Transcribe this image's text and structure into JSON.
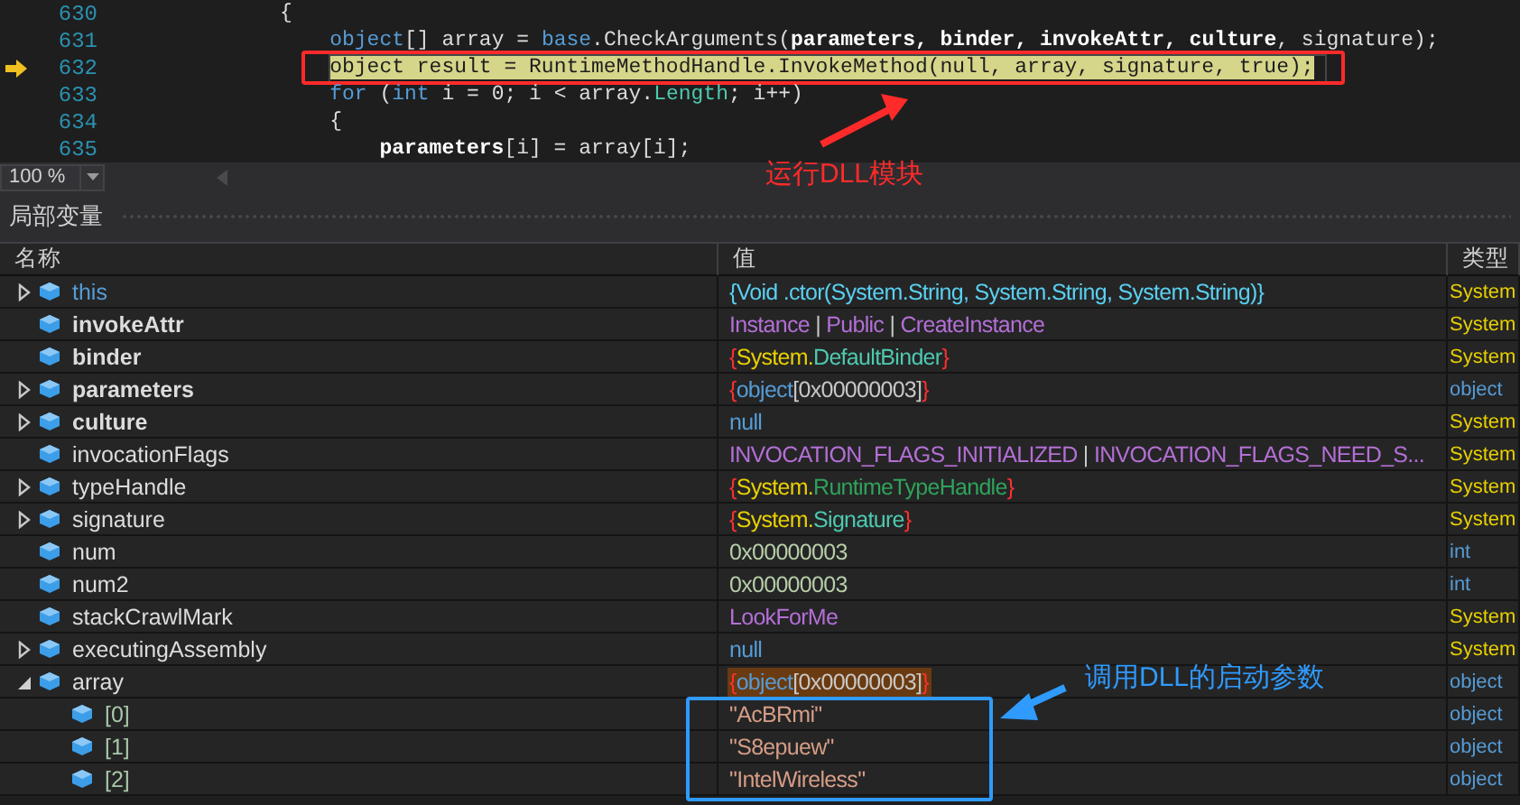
{
  "code": {
    "lines": [
      {
        "number": "630",
        "current": false,
        "tokens": [
          {
            "text": "{",
            "kind": "plain"
          }
        ],
        "children": [
          {
            "number": "631",
            "current": false,
            "tokens": [
              {
                "text": "object",
                "kind": "keyword"
              },
              {
                "text": "[] array = ",
                "kind": "plain"
              },
              {
                "text": "base",
                "kind": "keyword"
              },
              {
                "text": ".CheckArguments(",
                "kind": "plain"
              },
              {
                "text": "parameters, binder, invokeAttr, culture",
                "kind": "bold"
              },
              {
                "text": ", signature);",
                "kind": "plain"
              }
            ]
          },
          {
            "number": "632",
            "current": true,
            "tokens": [
              {
                "text": "object result = RuntimeMethodHandle.InvokeMethod(null, array, signature, true);",
                "kind": "plain"
              }
            ]
          },
          {
            "number": "633",
            "current": false,
            "tokens": [
              {
                "text": "for",
                "kind": "keyword"
              },
              {
                "text": " (",
                "kind": "plain"
              },
              {
                "text": "int",
                "kind": "keyword"
              },
              {
                "text": " i = 0; i < array.",
                "kind": "plain"
              },
              {
                "text": "Length",
                "kind": "type"
              },
              {
                "text": "; i++)",
                "kind": "plain"
              }
            ]
          },
          {
            "number": "634",
            "current": false,
            "tokens": [
              {
                "text": "{",
                "kind": "plain"
              }
            ],
            "children": [
              {
                "number": "635",
                "current": false,
                "tokens": [
                  {
                    "text": "parameters",
                    "kind": "bold"
                  },
                  {
                    "text": "[i] = array[i];",
                    "kind": "plain"
                  }
                ]
              }
            ]
          }
        ]
      }
    ]
  },
  "zoom": {
    "value": "100 %"
  },
  "annotations": [
    {
      "text": "运行DLL模块",
      "color": "#ff2a2a"
    },
    {
      "text": "调用DLL的启动参数",
      "color": "#2f9bff"
    }
  ],
  "locals": {
    "title": "局部变量",
    "columns": [
      "名称",
      "值",
      "类型"
    ],
    "rows": [
      {
        "name": "this",
        "expanded": false,
        "bold": false,
        "keyword": true,
        "value_highlighted": false,
        "value": [
          {
            "text": "{Void .ctor(System.String, System.String, System.String)}",
            "kind": "method"
          }
        ],
        "type": {
          "text": "System",
          "kind": "class"
        }
      },
      {
        "name": "invokeAttr",
        "bold": true,
        "keyword": false,
        "value_highlighted": false,
        "value": [
          {
            "text": "Instance",
            "kind": "enum"
          },
          {
            "text": " | ",
            "kind": "plain"
          },
          {
            "text": "Public",
            "kind": "enum"
          },
          {
            "text": " | ",
            "kind": "plain"
          },
          {
            "text": "CreateInstance",
            "kind": "enum"
          }
        ],
        "type": {
          "text": "System",
          "kind": "class"
        }
      },
      {
        "name": "binder",
        "bold": true,
        "keyword": false,
        "value_highlighted": false,
        "value": [
          {
            "text": "{",
            "kind": "brace"
          },
          {
            "text": "System.",
            "kind": "namespace"
          },
          {
            "text": "DefaultBinder",
            "kind": "class"
          },
          {
            "text": "}",
            "kind": "brace"
          }
        ],
        "type": {
          "text": "System",
          "kind": "class"
        }
      },
      {
        "name": "parameters",
        "expanded": false,
        "bold": true,
        "keyword": false,
        "value_highlighted": false,
        "value": [
          {
            "text": "{",
            "kind": "brace"
          },
          {
            "text": "object",
            "kind": "keyword"
          },
          {
            "text": "[0x00000003]",
            "kind": "plain"
          },
          {
            "text": "}",
            "kind": "brace"
          }
        ],
        "type": {
          "text": "object",
          "kind": "keyword"
        }
      },
      {
        "name": "culture",
        "expanded": false,
        "bold": true,
        "keyword": false,
        "value_highlighted": false,
        "value": [
          {
            "text": "null",
            "kind": "keyword"
          }
        ],
        "type": {
          "text": "System",
          "kind": "class"
        }
      },
      {
        "name": "invocationFlags",
        "bold": false,
        "keyword": false,
        "value_highlighted": false,
        "value": [
          {
            "text": "INVOCATION_FLAGS_INITIALIZED",
            "kind": "enum"
          },
          {
            "text": " | ",
            "kind": "plain"
          },
          {
            "text": "INVOCATION_FLAGS_NEED_S...",
            "kind": "enum"
          }
        ],
        "type": {
          "text": "System",
          "kind": "class"
        }
      },
      {
        "name": "typeHandle",
        "expanded": false,
        "bold": false,
        "keyword": false,
        "value_highlighted": false,
        "value": [
          {
            "text": "{",
            "kind": "brace"
          },
          {
            "text": "System.",
            "kind": "namespace"
          },
          {
            "text": "RuntimeTypeHandle",
            "kind": "struct"
          },
          {
            "text": "}",
            "kind": "brace"
          }
        ],
        "type": {
          "text": "System",
          "kind": "class"
        }
      },
      {
        "name": "signature",
        "expanded": false,
        "bold": false,
        "keyword": false,
        "value_highlighted": false,
        "value": [
          {
            "text": "{",
            "kind": "brace"
          },
          {
            "text": "System.",
            "kind": "namespace"
          },
          {
            "text": "Signature",
            "kind": "class"
          },
          {
            "text": "}",
            "kind": "brace"
          }
        ],
        "type": {
          "text": "System",
          "kind": "class"
        }
      },
      {
        "name": "num",
        "bold": false,
        "keyword": false,
        "value_highlighted": false,
        "value": [
          {
            "text": "0x00000003",
            "kind": "number"
          }
        ],
        "type": {
          "text": "int",
          "kind": "keyword"
        }
      },
      {
        "name": "num2",
        "bold": false,
        "keyword": false,
        "value_highlighted": false,
        "value": [
          {
            "text": "0x00000003",
            "kind": "number"
          }
        ],
        "type": {
          "text": "int",
          "kind": "keyword"
        }
      },
      {
        "name": "stackCrawlMark",
        "bold": false,
        "keyword": false,
        "value_highlighted": false,
        "value": [
          {
            "text": "LookForMe",
            "kind": "enum"
          }
        ],
        "type": {
          "text": "System",
          "kind": "class"
        }
      },
      {
        "name": "executingAssembly",
        "expanded": false,
        "bold": false,
        "keyword": false,
        "value_highlighted": false,
        "value": [
          {
            "text": "null",
            "kind": "keyword"
          }
        ],
        "type": {
          "text": "System",
          "kind": "class"
        }
      },
      {
        "name": "array",
        "expanded": true,
        "bold": false,
        "keyword": false,
        "value_highlighted": true,
        "value": [
          {
            "text": "{",
            "kind": "brace"
          },
          {
            "text": "object",
            "kind": "keyword"
          },
          {
            "text": "[0x00000003]",
            "kind": "plain"
          },
          {
            "text": "}",
            "kind": "brace"
          }
        ],
        "type": {
          "text": "object",
          "kind": "keyword"
        },
        "children": [
          {
            "name": "[0]",
            "bold": false,
            "keyword": false,
            "value_highlighted": false,
            "value": [
              {
                "text": "\"AcBRmi\"",
                "kind": "string"
              }
            ],
            "type": {
              "text": "object",
              "kind": "keyword"
            }
          },
          {
            "name": "[1]",
            "bold": false,
            "keyword": false,
            "value_highlighted": false,
            "value": [
              {
                "text": "\"S8epuew\"",
                "kind": "string"
              }
            ],
            "type": {
              "text": "object",
              "kind": "keyword"
            }
          },
          {
            "name": "[2]",
            "bold": false,
            "keyword": false,
            "value_highlighted": false,
            "value": [
              {
                "text": "\"IntelWireless\"",
                "kind": "string"
              }
            ],
            "type": {
              "text": "object",
              "kind": "keyword"
            }
          }
        ]
      }
    ]
  }
}
